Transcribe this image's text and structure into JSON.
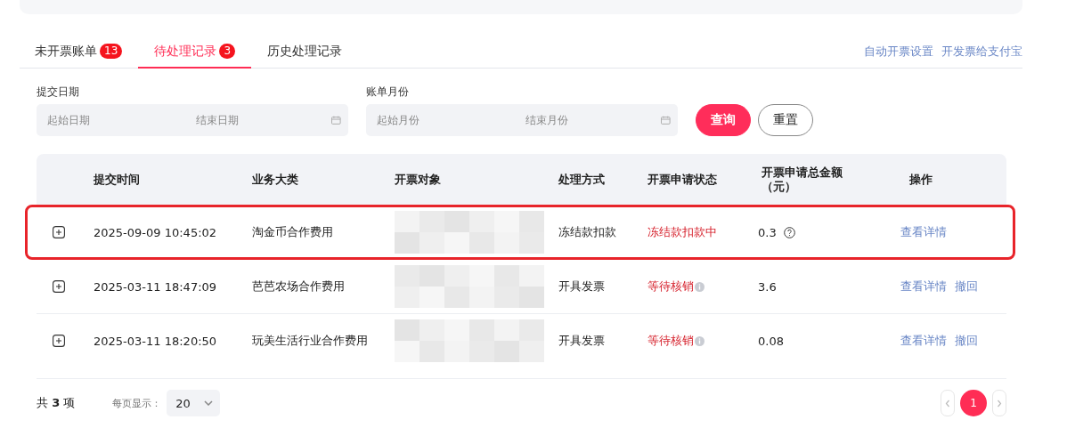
{
  "tabs": [
    {
      "label": "未开票账单",
      "badge": "13",
      "selected": false
    },
    {
      "label": "待处理记录",
      "badge": "3",
      "selected": true
    },
    {
      "label": "历史处理记录",
      "selected": false
    }
  ],
  "header_links": [
    "自动开票设置",
    "开发票给支付宝"
  ],
  "filters": [
    {
      "label": "提交日期",
      "start_placeholder": "起始日期",
      "end_placeholder": "结束日期"
    },
    {
      "label": "账单月份",
      "start_placeholder": "起始月份",
      "end_placeholder": "结束月份"
    }
  ],
  "buttons": [
    {
      "label": "查询",
      "kind": "primary"
    },
    {
      "label": "重置",
      "kind": "secondary"
    }
  ],
  "table": {
    "columns": [
      "提交时间",
      "业务大类",
      "开票对象",
      "处理方式",
      "开票申请状态",
      "开票申请总金额（元）",
      "操作"
    ],
    "rows": [
      {
        "time": "2025-09-09 10:45:02",
        "category": "淘金币合作费用",
        "method": "冻结款扣款",
        "status": "冻结款扣款中",
        "status_info": false,
        "amount": "0.3",
        "amount_help": true,
        "actions": [
          "查看详情"
        ],
        "highlighted": true
      },
      {
        "time": "2025-03-11 18:47:09",
        "category": "芭芭农场合作费用",
        "method": "开具发票",
        "status": "等待核销",
        "status_info": true,
        "amount": "3.6",
        "amount_help": false,
        "actions": [
          "查看详情",
          "撤回"
        ],
        "highlighted": false
      },
      {
        "time": "2025-03-11 18:20:50",
        "category": "玩美生活行业合作费用",
        "method": "开具发票",
        "status": "等待核销",
        "status_info": true,
        "amount": "0.08",
        "amount_help": false,
        "actions": [
          "查看详情",
          "撤回"
        ],
        "highlighted": false
      }
    ]
  },
  "footer": {
    "total": "共 **3** 项",
    "page_size_label": "每页显示：",
    "page_size": "20",
    "pages": [
      {
        "label": "1",
        "selected": true
      }
    ]
  }
}
